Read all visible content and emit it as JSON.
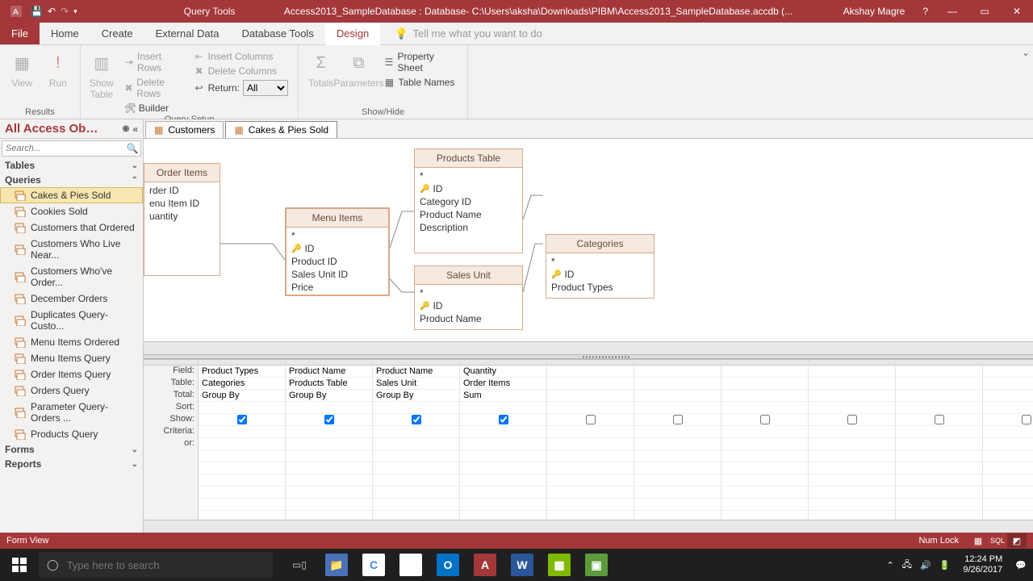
{
  "titlebar": {
    "context_tab": "Query Tools",
    "title": "Access2013_SampleDatabase : Database- C:\\Users\\aksha\\Downloads\\PIBM\\Access2013_SampleDatabase.accdb (...",
    "user": "Akshay Magre"
  },
  "menu": {
    "file": "File",
    "tabs": [
      "Home",
      "Create",
      "External Data",
      "Database Tools",
      "Design"
    ],
    "active": "Design",
    "tellme": "Tell me what you want to do"
  },
  "ribbon": {
    "results": {
      "view": "View",
      "run": "Run",
      "label": "Results"
    },
    "querytype": {
      "show_table": "Show\nTable",
      "insert_rows": "Insert Rows",
      "delete_rows": "Delete Rows",
      "builder": "Builder",
      "insert_cols": "Insert Columns",
      "delete_cols": "Delete Columns",
      "return": "Return:",
      "return_value": "All",
      "label": "Query Setup"
    },
    "showhide": {
      "totals": "Totals",
      "parameters": "Parameters",
      "property_sheet": "Property Sheet",
      "table_names": "Table Names",
      "label": "Show/Hide"
    }
  },
  "doctabs": {
    "tabs": [
      {
        "name": "Customers",
        "active": false
      },
      {
        "name": "Cakes & Pies Sold",
        "active": true
      }
    ]
  },
  "nav": {
    "header": "All Access Ob…",
    "search_placeholder": "Search...",
    "groups": {
      "tables": "Tables",
      "queries": "Queries",
      "forms": "Forms",
      "reports": "Reports"
    },
    "queries": [
      "Cakes & Pies Sold",
      "Cookies Sold",
      "Customers that Ordered",
      "Customers Who Live Near...",
      "Customers Who've Order...",
      "December Orders",
      "Duplicates Query- Custo...",
      "Menu Items Ordered",
      "Menu Items Query",
      "Order Items Query",
      "Orders Query",
      "Parameter Query- Orders ...",
      "Products Query"
    ],
    "selected_query": "Cakes & Pies Sold"
  },
  "diagram": {
    "order_items": {
      "title": "Order Items",
      "fields": [
        "rder ID",
        "enu Item ID",
        "uantity"
      ]
    },
    "menu_items": {
      "title": "Menu Items",
      "fields": [
        "*",
        "ID",
        "Product ID",
        "Sales Unit ID",
        "Price"
      ]
    },
    "products": {
      "title": "Products Table",
      "fields": [
        "*",
        "ID",
        "Category ID",
        "Product Name",
        "Description"
      ]
    },
    "sales_unit": {
      "title": "Sales Unit",
      "fields": [
        "*",
        "ID",
        "Product Name"
      ]
    },
    "categories": {
      "title": "Categories",
      "fields": [
        "*",
        "ID",
        "Product Types"
      ]
    }
  },
  "qbe": {
    "labels": {
      "field": "Field:",
      "table": "Table:",
      "total": "Total:",
      "sort": "Sort:",
      "show": "Show:",
      "criteria": "Criteria:",
      "or": "or:"
    },
    "cols": [
      {
        "field": "Product Types",
        "table": "Categories",
        "total": "Group By",
        "show": true
      },
      {
        "field": "Product Name",
        "table": "Products Table",
        "total": "Group By",
        "show": true
      },
      {
        "field": "Product Name",
        "table": "Sales Unit",
        "total": "Group By",
        "show": true
      },
      {
        "field": "Quantity",
        "table": "Order Items",
        "total": "Sum",
        "show": true
      },
      {
        "field": "",
        "table": "",
        "total": "",
        "show": false
      },
      {
        "field": "",
        "table": "",
        "total": "",
        "show": false
      },
      {
        "field": "",
        "table": "",
        "total": "",
        "show": false
      },
      {
        "field": "",
        "table": "",
        "total": "",
        "show": false
      },
      {
        "field": "",
        "table": "",
        "total": "",
        "show": false
      },
      {
        "field": "",
        "table": "",
        "total": "",
        "show": false
      }
    ]
  },
  "statusbar": {
    "left": "Form View",
    "numlock": "Num Lock"
  },
  "taskbar": {
    "search_placeholder": "Type here to search",
    "clock_time": "12:24 PM",
    "clock_date": "9/26/2017"
  }
}
